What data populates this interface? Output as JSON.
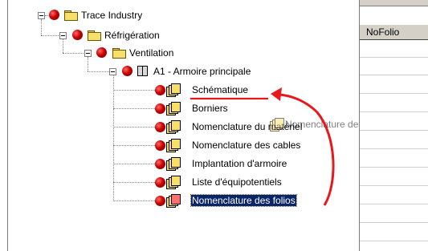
{
  "tree": {
    "root": {
      "label": "Trace Industry"
    },
    "level1": {
      "label": "Réfrigération"
    },
    "level2": {
      "label": "Ventilation"
    },
    "level3": {
      "label": "A1 - Armoire principale"
    },
    "items": [
      {
        "label": "Schématique"
      },
      {
        "label": "Borniers"
      },
      {
        "label": "Nomenclature du matériel"
      },
      {
        "label": "Nomenclature des cables"
      },
      {
        "label": "Implantation d'armoire"
      },
      {
        "label": "Liste d'équipotentiels"
      },
      {
        "label": "Nomenclature des folios",
        "selected": true
      }
    ]
  },
  "drag_ghost": {
    "label": "Nomenclature des folios"
  },
  "grid": {
    "column_header": "NoFolio"
  },
  "colors": {
    "selection": "#0a246a",
    "annotation_arrow": "#e8191d"
  }
}
